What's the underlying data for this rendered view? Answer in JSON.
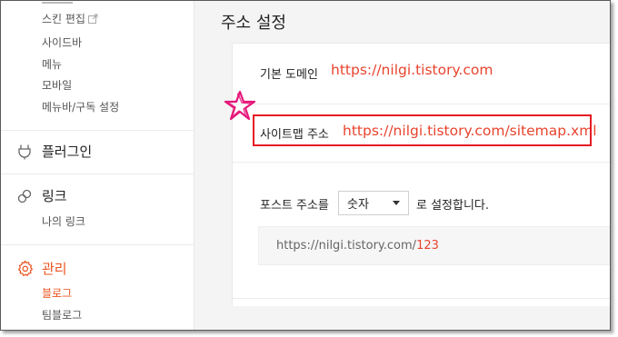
{
  "sidebar": {
    "top_items": [
      {
        "label": "스킨 편집"
      },
      {
        "label": "사이드바"
      },
      {
        "label": "메뉴"
      },
      {
        "label": "모바일"
      },
      {
        "label": "메뉴바/구독 설정"
      }
    ],
    "plugin": {
      "label": "플러그인",
      "icon": "plug-icon"
    },
    "link": {
      "label": "링크",
      "icon": "link-icon",
      "items": [
        {
          "label": "나의 링크"
        }
      ]
    },
    "manage": {
      "label": "관리",
      "icon": "gear-icon",
      "items": [
        {
          "label": "블로그"
        },
        {
          "label": "팀블로그"
        }
      ]
    }
  },
  "main": {
    "title": "주소 설정",
    "default_domain": {
      "label": "기본 도메인",
      "url": "https://nilgi.tistory.com"
    },
    "sitemap": {
      "label": "사이트맵 주소",
      "url": "https://nilgi.tistory.com/sitemap.xml"
    },
    "post_address": {
      "label": "포스트 주소를",
      "select_value": "숫자",
      "suffix": "로 설정합니다.",
      "preview_base": "https://nilgi.tistory.com/",
      "preview_num": "123"
    }
  },
  "colors": {
    "accent": "#eb531f",
    "url": "#e8442e",
    "highlight_border": "#e51b24",
    "star": "#e6197a"
  }
}
